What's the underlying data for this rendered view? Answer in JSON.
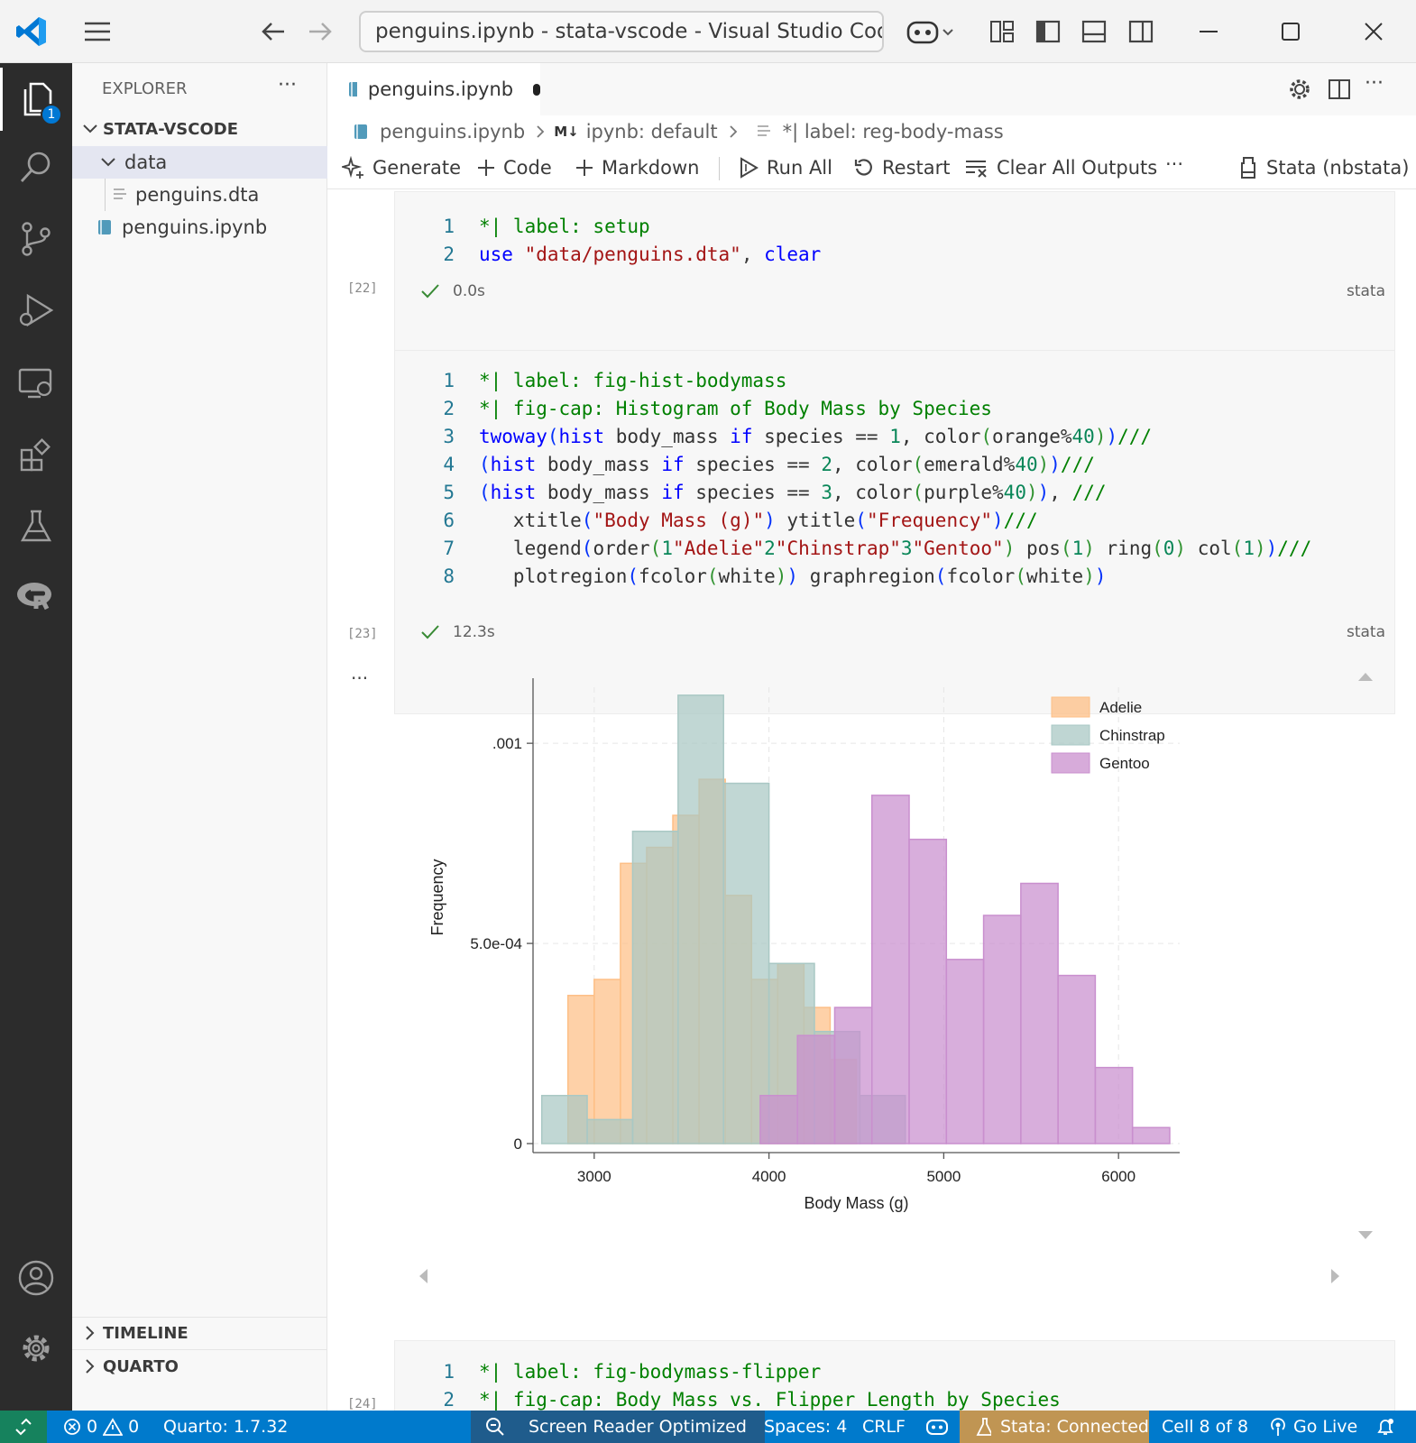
{
  "titlebar": {
    "command_center": "penguins.ipynb - stata-vscode - Visual Studio Cod"
  },
  "activity": {
    "explorer_badge": "1"
  },
  "sidebar": {
    "title": "EXPLORER",
    "more": "···",
    "workspace": "STATA-VSCODE",
    "tree": {
      "folder": "data",
      "file1": "penguins.dta",
      "file2": "penguins.ipynb"
    },
    "timeline": "TIMELINE",
    "quarto": "QUARTO"
  },
  "editor": {
    "tab_label": "penguins.ipynb",
    "breadcrumb": {
      "file": "penguins.ipynb",
      "kernel": "ipynb: default",
      "cell": "*| label: reg-body-mass",
      "md_badge": "M↓"
    },
    "toolbar": {
      "generate": "Generate",
      "code": "Code",
      "markdown": "Markdown",
      "run_all": "Run All",
      "restart": "Restart",
      "clear_outputs": "Clear All Outputs",
      "more": "···",
      "kernel": "Stata (nbstata)"
    }
  },
  "cells": {
    "cell1": {
      "exec": "[22]",
      "time": "0.0s",
      "lang": "stata",
      "lines": [
        "1",
        "2"
      ]
    },
    "cell2": {
      "exec": "[23]",
      "time": "12.3s",
      "lang": "stata",
      "lines": [
        "1",
        "2",
        "3",
        "4",
        "5",
        "6",
        "7",
        "8"
      ]
    },
    "cell3": {
      "exec": "[24]",
      "lines": [
        "1",
        "2"
      ]
    },
    "output_more": "..."
  },
  "chart_data": {
    "type": "bar",
    "xlabel": "Body Mass (g)",
    "ylabel": "Frequency",
    "xticks": [
      "3000",
      "4000",
      "5000",
      "6000"
    ],
    "yticks": [
      ".001",
      "5.0e-04",
      "0"
    ],
    "legend": [
      "Adelie",
      "Chinstrap",
      "Gentoo"
    ],
    "legend_position": "top-right",
    "xlim": [
      2650,
      6350
    ],
    "ylim": [
      0,
      0.00114
    ],
    "grid": true,
    "series": [
      {
        "name": "Adelie",
        "color": "#fdbf86",
        "bin_width": 150,
        "bins": [
          [
            2850,
            0.00037
          ],
          [
            3000,
            0.00041
          ],
          [
            3150,
            0.0007
          ],
          [
            3300,
            0.00074
          ],
          [
            3450,
            0.00082
          ],
          [
            3600,
            0.00091
          ],
          [
            3750,
            0.00062
          ],
          [
            3900,
            0.00041
          ],
          [
            4050,
            0.00045
          ],
          [
            4200,
            0.00034
          ],
          [
            4350,
            0.00021
          ],
          [
            4500,
            0.0
          ]
        ]
      },
      {
        "name": "Chinstrap",
        "color": "#a9c8c4",
        "bin_width": 260,
        "bins": [
          [
            2700,
            0.00012
          ],
          [
            2960,
            6e-05
          ],
          [
            3220,
            0.00078
          ],
          [
            3480,
            0.00112
          ],
          [
            3740,
            0.0009
          ],
          [
            4000,
            0.00045
          ],
          [
            4260,
            0.00028
          ],
          [
            4520,
            0.00012
          ]
        ]
      },
      {
        "name": "Gentoo",
        "color": "#c98fce",
        "bin_width": 213,
        "bins": [
          [
            3950,
            0.00012
          ],
          [
            4163,
            0.00027
          ],
          [
            4376,
            0.00034
          ],
          [
            4589,
            0.00087
          ],
          [
            4802,
            0.00076
          ],
          [
            5015,
            0.00046
          ],
          [
            5228,
            0.00057
          ],
          [
            5441,
            0.00065
          ],
          [
            5654,
            0.00042
          ],
          [
            5867,
            0.00019
          ],
          [
            6080,
            4e-05
          ]
        ]
      }
    ]
  },
  "statusbar": {
    "errors": "0",
    "warnings": "0",
    "quarto": "Quarto: 1.7.32",
    "screen_reader": "Screen Reader Optimized",
    "spaces": "Spaces: 4",
    "eol": "CRLF",
    "stata": "Stata: Connected",
    "cell": "Cell 8 of 8",
    "golive": "Go Live"
  },
  "colors": {
    "accent": "#007acc",
    "stata_item": "#c09553",
    "activity_bar": "#2c2c2c"
  }
}
